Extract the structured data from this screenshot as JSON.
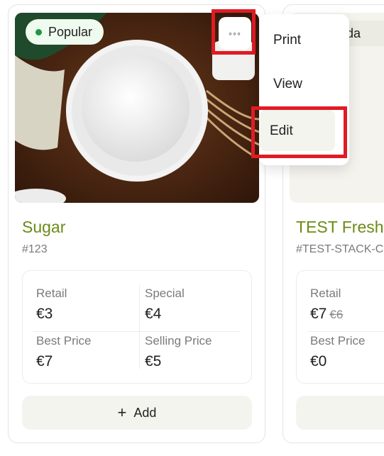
{
  "cards": [
    {
      "badge": "Popular",
      "title": "Sugar",
      "sku": "#123",
      "prices": [
        {
          "label": "Retail",
          "value": "€3"
        },
        {
          "label": "Special",
          "value": "€4"
        },
        {
          "label": "Best Price",
          "value": "€7"
        },
        {
          "label": "Selling Price",
          "value": "€5"
        }
      ],
      "add_label": "Add",
      "more_label": "◦◦◦"
    },
    {
      "badge": "e Upda",
      "title": "TEST Fresh",
      "sku": "#TEST-STACK-C",
      "prices": [
        {
          "label": "Retail",
          "value": "€7",
          "old_value": "€6"
        },
        {
          "label": "Best Price",
          "value": "€0"
        }
      ]
    }
  ],
  "menu": {
    "items": [
      "Print",
      "View",
      "Edit"
    ]
  },
  "colors": {
    "title": "#6c8a16",
    "highlight": "#e01b24",
    "badge_bg": "#effbee",
    "badge_dot": "#1b9a3f"
  }
}
